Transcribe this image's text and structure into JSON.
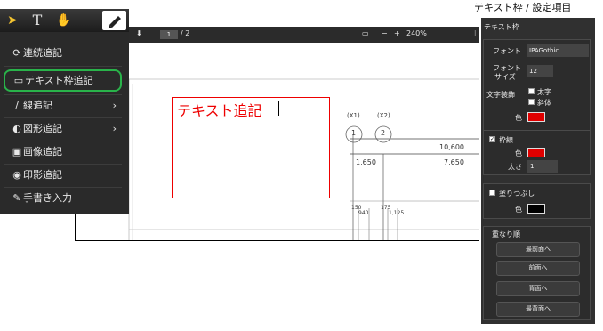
{
  "caption": "テキスト枠 / 設定項目",
  "toolbar": {
    "text_tool_label": "T",
    "icons": [
      "pointer-icon",
      "text-tool-icon",
      "hand-icon",
      "pencil-icon"
    ]
  },
  "menu": {
    "items": [
      {
        "label": "連続追記",
        "icon": "continuous-icon",
        "has_submenu": false
      },
      {
        "label": "テキスト枠追記",
        "icon": "textbox-icon",
        "has_submenu": false,
        "highlighted": true
      },
      {
        "label": "線追記",
        "icon": "line-icon",
        "has_submenu": true
      },
      {
        "label": "図形追記",
        "icon": "shape-icon",
        "has_submenu": true
      },
      {
        "label": "画像追記",
        "icon": "image-icon",
        "has_submenu": false
      },
      {
        "label": "印影追記",
        "icon": "stamp-icon",
        "has_submenu": false
      },
      {
        "label": "手書き入力",
        "icon": "handwriting-icon",
        "has_submenu": false
      }
    ],
    "highlight_color": "#29b34a",
    "submenu_arrow": "›"
  },
  "viewer": {
    "page_current": "1",
    "page_total": "/ 2",
    "zoom": "240%",
    "zoom_out": "−",
    "zoom_in": "+"
  },
  "drawing": {
    "circle_labels": [
      {
        "top": "(X1)",
        "num": "1"
      },
      {
        "top": "(X2)",
        "num": "2"
      }
    ],
    "dimensions": [
      "10,600",
      "1,650",
      "7,650",
      "150",
      "940",
      "175",
      "1,125"
    ],
    "annotation_text": "テキスト追記",
    "annotation_color": "#e00000"
  },
  "panel": {
    "title": "テキスト枠",
    "font_label": "フォント",
    "font_value": "IPAGothic",
    "size_label_1": "フォント",
    "size_label_2": "サイズ",
    "size_value": "12",
    "decoration_label": "文字装飾",
    "bold_label": "太字",
    "bold_checked": false,
    "italic_label": "斜体",
    "italic_checked": false,
    "text_color_label": "色",
    "text_color": "#e00000",
    "border_label": "枠線",
    "border_checked": true,
    "border_color_label": "色",
    "border_color": "#e00000",
    "thickness_label": "太さ",
    "thickness_value": "1",
    "fill_label": "塗りつぶし",
    "fill_checked": false,
    "fill_color_label": "色",
    "fill_color": "#000000",
    "order_label": "重なり順",
    "order_buttons": [
      "最前面へ",
      "前面へ",
      "背面へ",
      "最背面へ"
    ]
  }
}
